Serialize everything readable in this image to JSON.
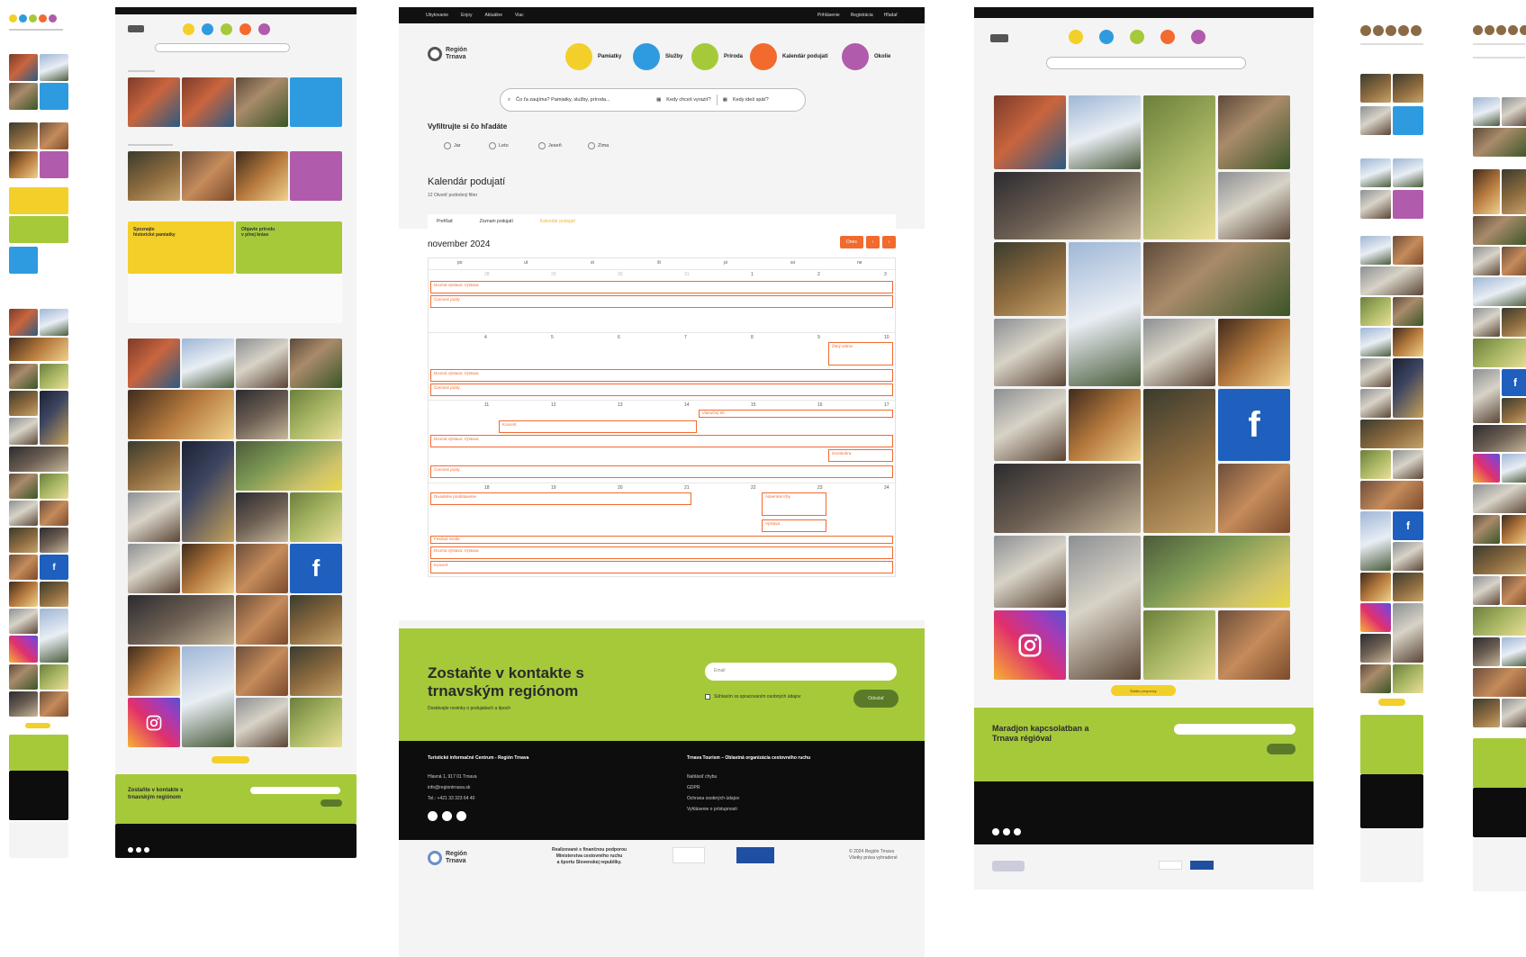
{
  "colors": {
    "yellow": "#f3cf2a",
    "blue": "#2e9be0",
    "green": "#a6c93a",
    "orange": "#f26a2e",
    "purple": "#b05bab",
    "black": "#0d0d0d"
  },
  "main": {
    "topbar": {
      "left": [
        "Ubytovanie",
        "Enjoy",
        "Aktuálne",
        "Viac"
      ],
      "right": [
        "Prihlásenie",
        "Registrácia",
        "Hľadať"
      ]
    },
    "logo": {
      "line1": "Región",
      "line2": "Trnava"
    },
    "categories": [
      {
        "label": "Pamiatky",
        "color": "#f3cf2a",
        "icon": "pamiatky-icon"
      },
      {
        "label": "Služby",
        "color": "#2e9be0",
        "icon": "sluzby-icon"
      },
      {
        "label": "Príroda",
        "color": "#a6c93a",
        "icon": "priroda-icon"
      },
      {
        "label": "Kalendár podujatí",
        "color": "#f26a2e",
        "icon": "kalendar-icon"
      },
      {
        "label": "Okolie",
        "color": "#b05bab",
        "icon": "okolie-icon"
      }
    ],
    "search": {
      "placeholder": "Čo ťa zaujíma? Pamiatky, služby, príroda...",
      "from": "Kedy chceš vyraziť?",
      "to": "Kedy ideš späť?"
    },
    "filter_title": "Vyfiltrujte si čo hľadáte",
    "filters": [
      "Jar",
      "Leto",
      "Jeseň",
      "Zima"
    ],
    "calendar": {
      "title": "Kalendár podujatí",
      "subtitle": "12 Otvoriť podrobný filter",
      "tabs": [
        "Prehľad",
        "Zoznam podujatí",
        "Kalendár podujatí"
      ],
      "month": "november 2024",
      "today_btn": "Dnes",
      "prev": "‹",
      "next": "›",
      "weekdays": [
        "po",
        "ut",
        "st",
        "št",
        "pi",
        "so",
        "ne"
      ],
      "week1": [
        "28",
        "29",
        "30",
        "31",
        "1",
        "2",
        "3"
      ],
      "week2": [
        "4",
        "5",
        "6",
        "7",
        "8",
        "9",
        "10"
      ],
      "week3": [
        "11",
        "12",
        "13",
        "14",
        "15",
        "16",
        "17"
      ],
      "week4": [
        "18",
        "19",
        "20",
        "21",
        "22",
        "23",
        "24"
      ],
      "events": [
        "Dvorná výstava: Výstava",
        "Čarovné jazdy",
        "Žitný ostrov",
        "Vianočný trh",
        "Koncert",
        "Zvonkohra",
        "Divadelné predstavenie",
        "Adventné trhy",
        "Výstava",
        "Festival svetla"
      ]
    },
    "newsletter": {
      "title_1": "Zostaňte v kontakte s",
      "title_2": "trnavským regiónom",
      "subtitle": "Dostávajte novinky o podujatiach a tipoch",
      "email_placeholder": "Email",
      "consent": "Súhlasím so spracovaním osobných údajov",
      "button": "Odoslať"
    },
    "footer": {
      "col1_title": "Turistické informačné Centrum - Región Trnava",
      "col1_lines": [
        "Hlavná 1, 917 01 Trnava",
        "info@regiontrnava.sk",
        "Tel.: +421 33 323 64 40"
      ],
      "col2_title": "Trnava Tourism – Oblastná organizácia cestovného ruchu",
      "col2_lines": [
        "Nahlásiť chybu",
        "GDPR",
        "Ochrana osobných údajov",
        "Vyhlásenie o prístupnosti"
      ]
    },
    "bottom": {
      "logo_line1": "Región",
      "logo_line2": "Trnava",
      "note_lines": [
        "Realizované s finančnou podporou",
        "Ministerstva cestovného ruchu",
        "a športu Slovenskej republiky."
      ],
      "copyright_1": "© 2024 Región Trnava",
      "copyright_2": "Všetky práva vyhradené"
    }
  },
  "col4": {
    "newsletter_title_1": "Maradjon kapcsolatban a",
    "newsletter_title_2": "Trnava régióval",
    "load_more": "Ďalšie príspevky"
  },
  "col2": {
    "cta_1_1": "Spoznajte",
    "cta_1_2": "historické pamiatky",
    "cta_2_1": "Objavte prírodu",
    "cta_2_2": "v plnej kráse",
    "newsletter_title_1": "Zostaňte v kontakte s",
    "newsletter_title_2": "trnavským regiónom"
  },
  "icons": {
    "facebook": "facebook-icon",
    "instagram": "instagram-icon",
    "search": "search-icon",
    "calendar": "calendar-icon"
  }
}
